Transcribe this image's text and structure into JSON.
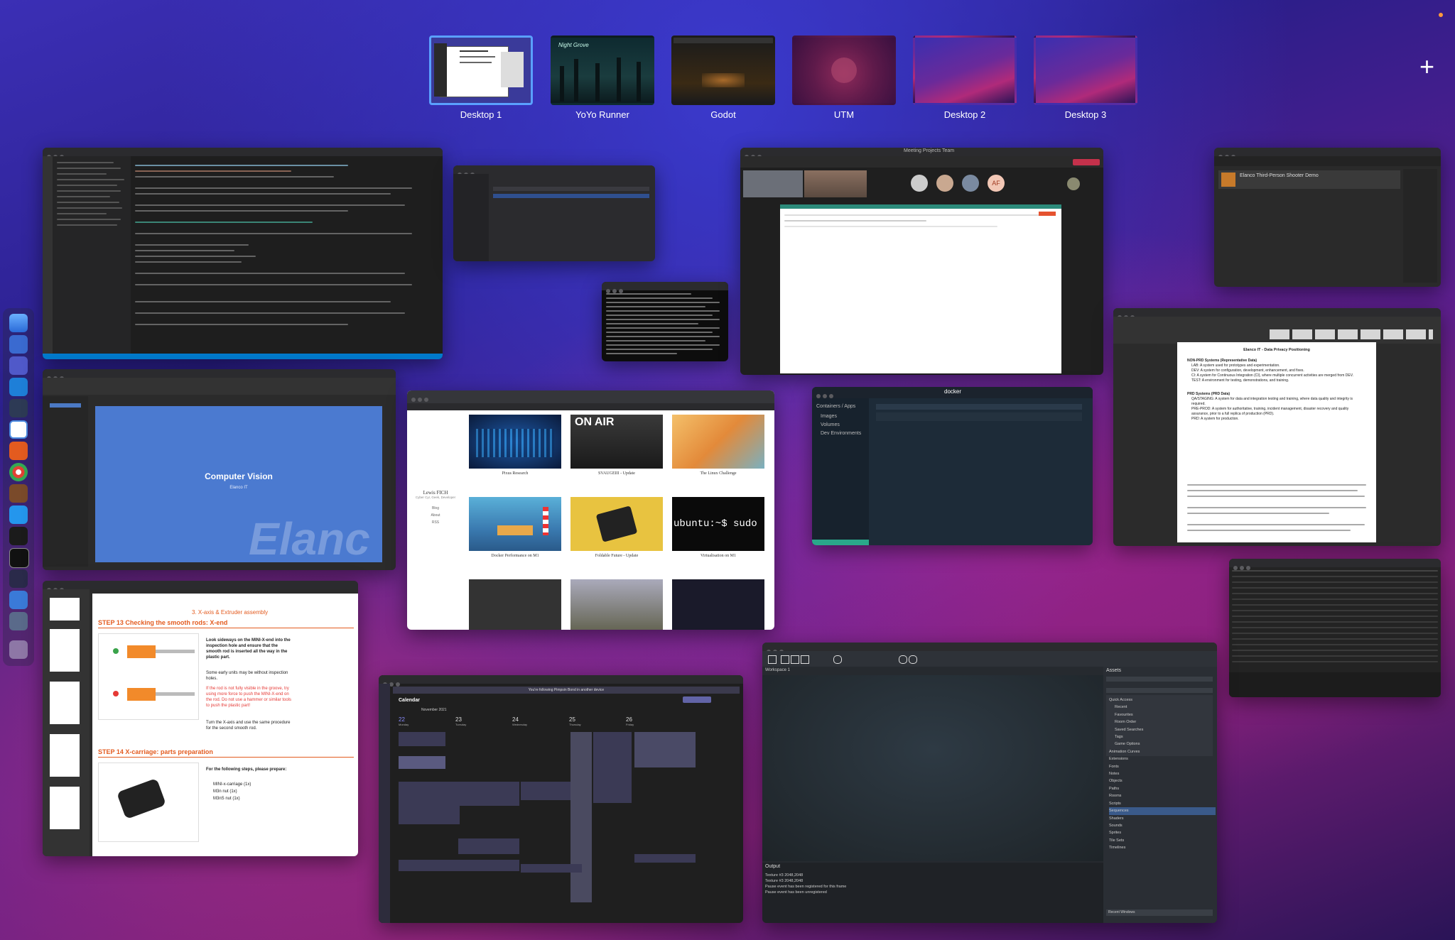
{
  "spaces": [
    {
      "label": "Desktop 1",
      "active": true
    },
    {
      "label": "YoYo Runner"
    },
    {
      "label": "Godot"
    },
    {
      "label": "UTM"
    },
    {
      "label": "Desktop 2"
    },
    {
      "label": "Desktop 3"
    }
  ],
  "add_space_label": "+",
  "yoyo_thumb_text": "Night Grove",
  "keynote": {
    "title": "Computer Vision",
    "subtitle": "Elanco IT",
    "watermark": "Elanc"
  },
  "blog": {
    "site_name": "Lewis FICH",
    "site_sub": "Cyber Cyr, Geek, Developer",
    "nav": [
      "Blog",
      "About",
      "RSS"
    ],
    "posts": [
      "Pixus Research",
      "SVAUGEIII - Update",
      "The Linux Challenge",
      "Docker Performance on M1",
      "Foldable Future - Update",
      "Virtualisation on M1"
    ],
    "onair": "ON AIR",
    "sudo": "ubuntu:~$ sudo"
  },
  "pdf": {
    "section": "3. X-axis & Extruder assembly",
    "step13": "STEP 13 Checking the smooth rods: X-end",
    "step13_text": "Look sideways on the MINI-X-end into the inspection hole and ensure that the smooth rod is inserted all the way in the plastic part.",
    "note1": "Some early units may be without inspection holes.",
    "warn": "If the rod is not fully visible in the groove, try using more force to push the MINI-X-end on the rod. Do not use a hammer or similar tools to push the plastic part!",
    "step13_b": "Turn the X-axis and use the same procedure for the second smooth rod.",
    "step14": "STEP 14 X-carriage: parts preparation",
    "prepare": "For the following steps, please prepare:",
    "parts": [
      "MINI-x-carriage (1x)",
      "M3n nut (1x)",
      "M3nS nut (1x)"
    ]
  },
  "doc": {
    "heading": "Elanco IT - Data Privacy Positioning",
    "sub": "NON-PRD Systems (Representative Data)",
    "bullets": [
      "LAB: A system used for prototypes and experimentation.",
      "DEV: A system for configuration, development, enhancement, and fixes.",
      "CI: A system for Continuous Integration (CI), where multiple concurrent activities are merged from DEV.",
      "TEST: A environment for testing, demonstrations, and training."
    ],
    "sub2": "PRD Systems (PRD Data)",
    "bullets2": [
      "QA/STAGING: A system for data and integration testing and training, where data quality and integrity is required.",
      "PRE-PROD: A system for authoritative, training, incident management, disaster recovery and quality assurance, prior to a full replica of production (PRD).",
      "PRD: A system for production."
    ]
  },
  "calendar": {
    "title": "Calendar",
    "month": "November 2021",
    "banner": "You're following Pimpsin Bond in another device",
    "days": [
      "22",
      "23",
      "24",
      "25",
      "26"
    ],
    "day_names": [
      "Monday",
      "Tuesday",
      "Wednesday",
      "Thursday",
      "Friday"
    ]
  },
  "godot": {
    "workspace": "Workspace 1",
    "assets_label": "Assets",
    "tree": [
      "Quick Access",
      "Recent",
      "Favourites",
      "Room Order",
      "Saved Searches",
      "Tags",
      "Game Options",
      "Animation Curves",
      "Extensions",
      "Fonts",
      "Notes",
      "Objects",
      "Paths",
      "Rooms",
      "Scripts",
      "Sequences",
      "Shaders",
      "Sounds",
      "Sprites",
      "Tile Sets",
      "Timelines"
    ],
    "output_label": "Output",
    "output_lines": [
      "Texture #3 2048,2048",
      "Texture #3 2048,2048",
      "Pause event has been registered for this frame",
      "Pause event has been unregistered"
    ],
    "recent_windows": "Recent Windows"
  },
  "meeting": {
    "title": "Meeting Projects Team",
    "initials": [
      "AF"
    ]
  },
  "docker": {
    "name": "docker",
    "side": [
      "Containers / Apps",
      "Images",
      "Volumes",
      "Dev Environments"
    ]
  },
  "zoom_title": "Elanco Third-Person Shooter Demo"
}
